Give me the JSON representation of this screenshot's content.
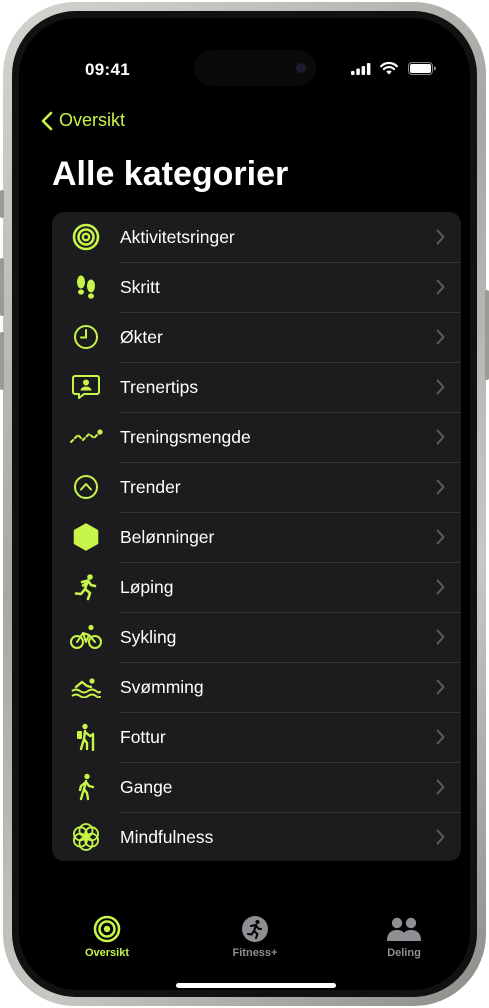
{
  "status_bar": {
    "time": "09:41"
  },
  "nav": {
    "back_label": "Oversikt",
    "title": "Alle kategorier"
  },
  "categories": [
    {
      "label": "Aktivitetsringer",
      "icon": "activity-rings-icon"
    },
    {
      "label": "Skritt",
      "icon": "footprints-icon"
    },
    {
      "label": "Økter",
      "icon": "clock-icon"
    },
    {
      "label": "Trenertips",
      "icon": "coach-tips-icon"
    },
    {
      "label": "Treningsmengde",
      "icon": "training-load-icon"
    },
    {
      "label": "Trender",
      "icon": "trends-icon"
    },
    {
      "label": "Belønninger",
      "icon": "awards-icon"
    },
    {
      "label": "Løping",
      "icon": "running-icon"
    },
    {
      "label": "Sykling",
      "icon": "cycling-icon"
    },
    {
      "label": "Svømming",
      "icon": "swimming-icon"
    },
    {
      "label": "Fottur",
      "icon": "hiking-icon"
    },
    {
      "label": "Gange",
      "icon": "walking-icon"
    },
    {
      "label": "Mindfulness",
      "icon": "mindfulness-icon"
    }
  ],
  "tab_bar": {
    "tabs": [
      {
        "label": "Oversikt",
        "icon": "activity-rings-icon",
        "selected": true
      },
      {
        "label": "Fitness+",
        "icon": "fitness-plus-icon",
        "selected": false
      },
      {
        "label": "Deling",
        "icon": "sharing-icon",
        "selected": false
      }
    ]
  },
  "colors": {
    "accent": "#c8f54a",
    "background": "#000000",
    "list_background": "#1c1c1e",
    "inactive_tab": "#8e8e93"
  }
}
